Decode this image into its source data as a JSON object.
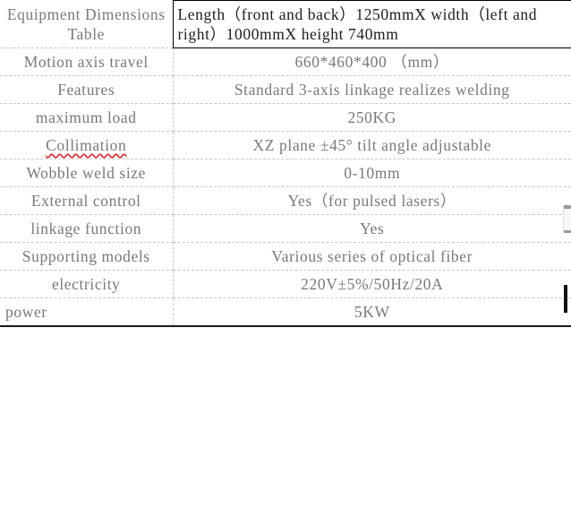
{
  "document": {
    "type": "specification-table",
    "colors": {
      "text": "#77797c",
      "selected_text": "#1c1c1c",
      "grid_line": "#c8c8c8",
      "selection_border": "#000000",
      "spellcheck_underline": "#e03131",
      "bottom_border": "#1a1a1a"
    },
    "columns": 2
  },
  "table": {
    "rows": [
      {
        "label": "Equipment Dimensions Table",
        "value": "Length（front and back）1250mmX width（left and right）1000mmX height 740mm",
        "selected": true,
        "label_align": "center",
        "value_align": "left"
      },
      {
        "label": "Motion axis travel",
        "value": "660*460*400 （mm）",
        "selected": false,
        "label_align": "center",
        "value_align": "center"
      },
      {
        "label": "Features",
        "value": "Standard 3-axis linkage realizes welding",
        "selected": false,
        "label_align": "center",
        "value_align": "center"
      },
      {
        "label": "maximum load",
        "value": "250KG",
        "selected": false,
        "label_align": "center",
        "value_align": "center"
      },
      {
        "label": "Collimation",
        "value": "XZ plane ±45° tilt angle adjustable",
        "selected": false,
        "label_align": "center",
        "value_align": "center",
        "label_spellcheck": true
      },
      {
        "label": "Wobble weld size",
        "value": "0-10mm",
        "selected": false,
        "label_align": "center",
        "value_align": "center"
      },
      {
        "label": "External control",
        "value": "Yes（for pulsed lasers）",
        "selected": false,
        "label_align": "center",
        "value_align": "center"
      },
      {
        "label": "linkage function",
        "value": "Yes",
        "selected": false,
        "label_align": "center",
        "value_align": "center"
      },
      {
        "label": "Supporting models",
        "value": "Various series of optical fiber",
        "selected": false,
        "label_align": "center",
        "value_align": "center"
      },
      {
        "label": "electricity",
        "value": "220V±5%/50Hz/20A",
        "selected": false,
        "label_align": "center",
        "value_align": "center"
      },
      {
        "label": "power",
        "value": "5KW",
        "selected": false,
        "label_align": "left",
        "value_align": "center"
      }
    ]
  },
  "overlays": {
    "scrollbar_label": "mini-scrollbar",
    "caret_label": "text-caret"
  }
}
